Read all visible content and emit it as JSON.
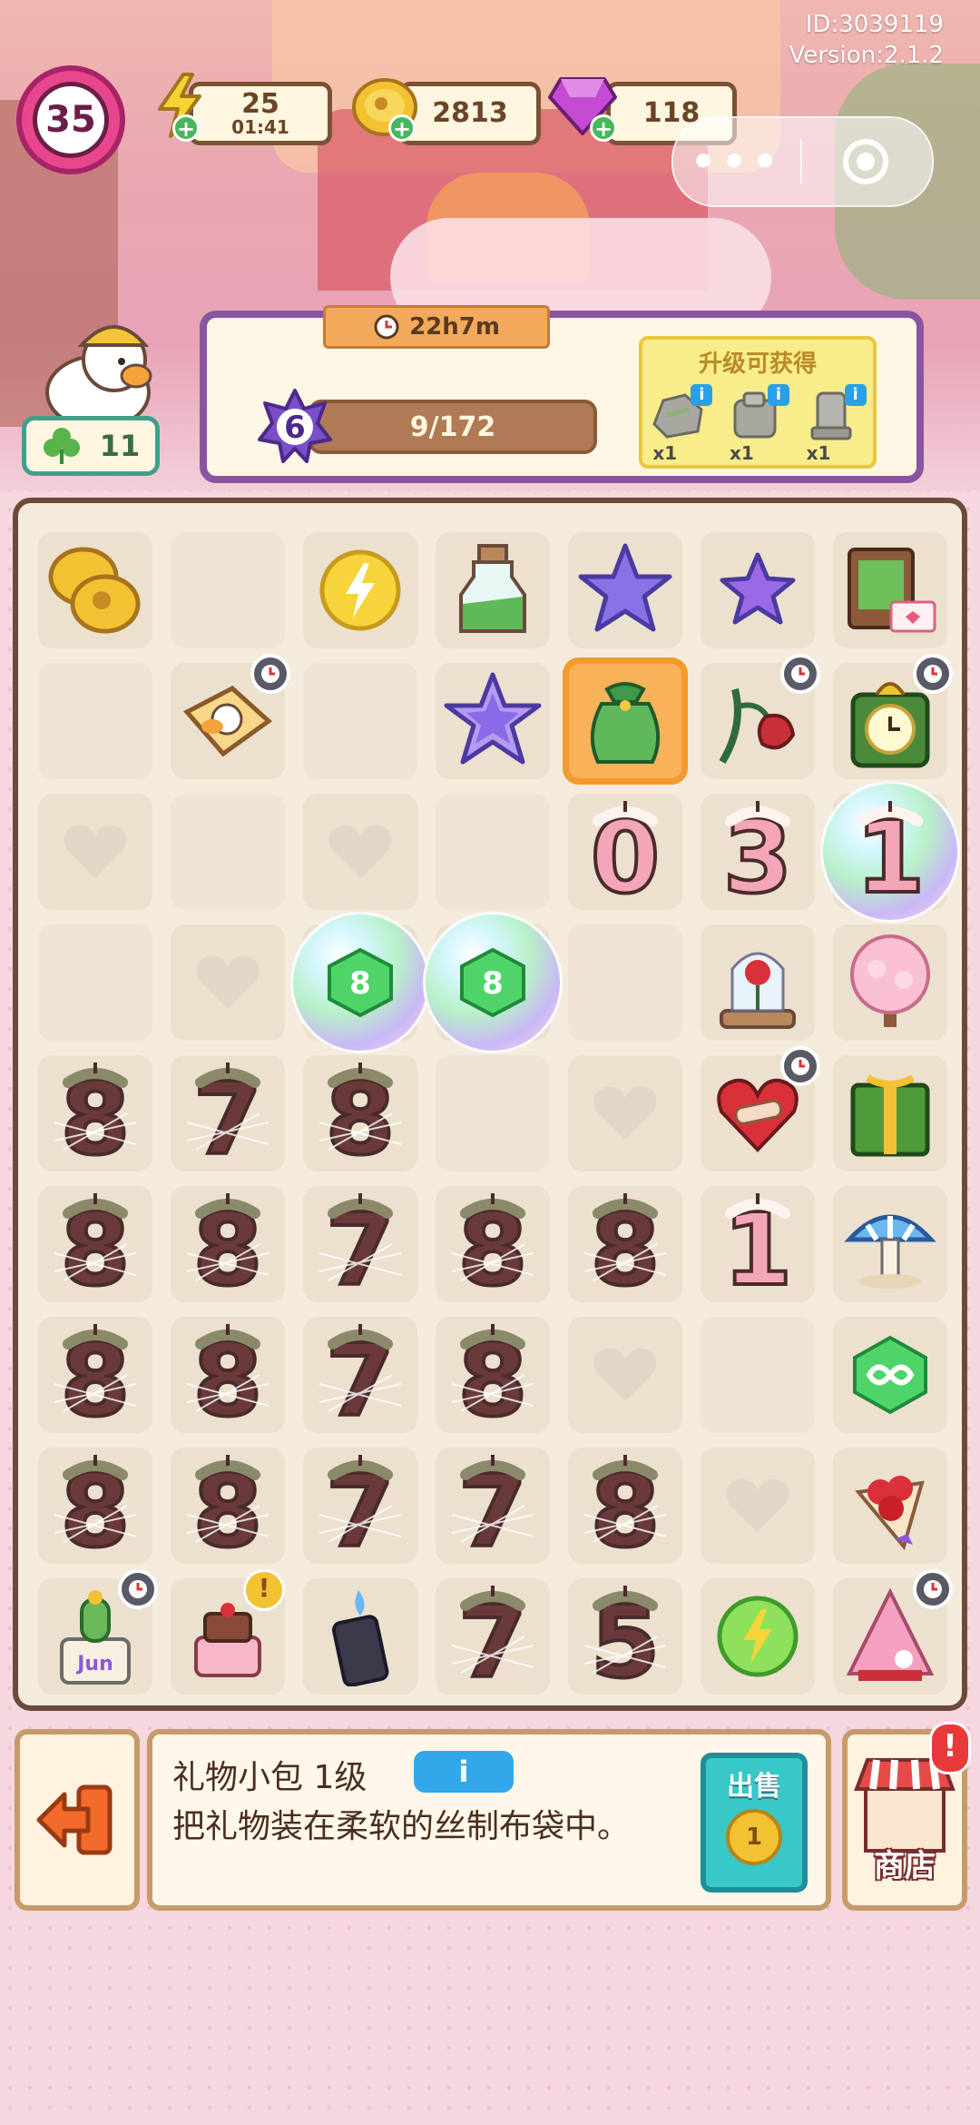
{
  "header": {
    "id_text": "ID:3039119",
    "version_text": "Version:2.1.2",
    "level": "35",
    "energy": {
      "value": "25",
      "timer": "01:41"
    },
    "coins": "2813",
    "gems": "118",
    "clover": "11"
  },
  "quest": {
    "timer": "22h7m",
    "level": "6",
    "progress_text": "9/172",
    "rewards_title": "升级可获得",
    "rewards": [
      {
        "name": "rock-item",
        "qty": "x1"
      },
      {
        "name": "rubble-item",
        "qty": "x1"
      },
      {
        "name": "stone-pillar-item",
        "qty": "x1"
      }
    ]
  },
  "board": {
    "cols": 7,
    "rows": 9,
    "selected": [
      1,
      4
    ],
    "cells": [
      [
        "coin-stack",
        "empty",
        "energy-orb",
        "potion-bottle",
        "purple-star-large",
        "purple-star-small",
        "gift-box-card"
      ],
      [
        "empty",
        "toast-duck-timer",
        "empty",
        "purple-star-outline",
        "green-gift-bag",
        "wilted-rose-timer",
        "green-clock-timer"
      ],
      [
        "heart-slot",
        "empty",
        "heart-slot",
        "empty",
        "number-candle-0",
        "number-candle-3",
        "number-candle-1-bubble"
      ],
      [
        "empty",
        "heart-slot",
        "gem-8-bubble",
        "gem-8-bubble",
        "empty",
        "rose-dome",
        "blossom-tree"
      ],
      [
        "web-candle-8",
        "web-candle-7",
        "web-candle-8",
        "empty",
        "heart-slot",
        "bandage-heart-timer",
        "green-present"
      ],
      [
        "web-candle-8",
        "web-candle-8",
        "web-candle-7",
        "web-candle-8",
        "web-candle-8",
        "number-candle-1",
        "blue-mushroom-lamp"
      ],
      [
        "web-candle-8",
        "web-candle-8",
        "web-candle-7",
        "web-candle-8",
        "heart-slot",
        "empty",
        "infinity-gem"
      ],
      [
        "web-candle-8",
        "web-candle-8",
        "web-candle-7",
        "web-candle-7",
        "web-candle-8",
        "heart-slot",
        "rose-bouquet"
      ],
      [
        "cactus-pot-timer",
        "birthday-cake-alert",
        "lighter-canister",
        "web-candle-7",
        "web-candle-5",
        "energy-orb-green",
        "pink-tree-timer"
      ]
    ]
  },
  "info": {
    "item_name": "礼物小包 1级",
    "info_button": "i",
    "description": "把礼物装在柔软的丝制布袋中。",
    "sell_label": "出售",
    "sell_price": "1"
  },
  "shop": {
    "label": "商店",
    "alert": "!"
  },
  "colors": {
    "panel_border": "#8a55a0",
    "board_border": "#6a4a3a",
    "selection": "#f39a2c",
    "sell_button": "#38c8c8",
    "info_button": "#33a8e8"
  }
}
